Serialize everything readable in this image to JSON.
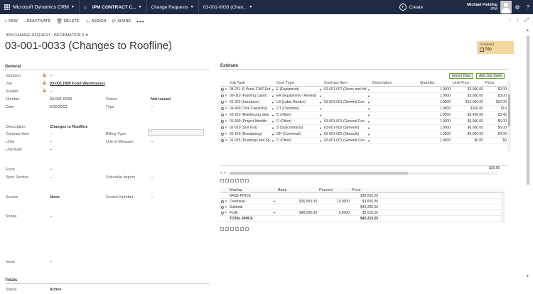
{
  "topbar": {
    "app_title": "Microsoft Dynamics CRM",
    "entity_tab": "IPM CONTRACT C...",
    "change_requests": "Change Requests",
    "record_tab": "03-001-0033 (Chan...",
    "create": "Create",
    "user_name": "Michael Fielding",
    "user_org": "IPM"
  },
  "cmdbar": {
    "new": "NEW",
    "deactivate": "DEACTIVATE",
    "delete": "DELETE",
    "assign": "ASSIGN",
    "share": "SHARE",
    "more": "•••"
  },
  "header": {
    "entity_label": "IPM CHANGE REQUEST : INFORMATION 2",
    "title": "03-001-0033 (Changes to Roofline)",
    "status_label": "Finalized",
    "status_value": "No"
  },
  "general": {
    "section": "General",
    "variation_label": "Variation",
    "variation_value": "--",
    "job_label": "Job",
    "job_value": "03-001 (NW Food Warehouse)",
    "subjob_label": "Subjob",
    "subjob_value": "--",
    "number_label": "Number",
    "number_value": "03-001-0033",
    "status_label": "Status",
    "status_value": "Not issued",
    "date_label": "Date",
    "date_value": "6/10/2013",
    "type_label": "Type",
    "type_value": "--",
    "description_label": "Description",
    "description_value": "Changes to Roofline",
    "contract_item_label": "Contract Item",
    "contract_item_value": "--",
    "billing_type_label": "Billing Type",
    "billing_type_value": "--",
    "units_label": "Units",
    "units_value": "--",
    "uom_label": "Unit of Measure",
    "uom_value": "--",
    "unit_rate_label": "Unit Rate",
    "unit_rate_value": "--",
    "from_label": "From",
    "from_value": "--",
    "spec_section_label": "Spec Section",
    "spec_section_value": "--",
    "schedule_impact_label": "Schedule Impact",
    "schedule_impact_value": "--",
    "source_label": "Source",
    "source_value": "None",
    "source_number_label": "Source Number",
    "source_number_value": "--",
    "scope_label": "Scope",
    "scope_value": "--",
    "issue_label": "Issue",
    "issue_value": "--"
  },
  "totals": {
    "section": "Totals",
    "status_label": "Status",
    "status_value": "Active"
  },
  "estimate": {
    "section": "Estimate",
    "import_btn": "Import Data",
    "add_tasks_btn": "Add Job Tasks",
    "columns": [
      "Job Task",
      "Cost Type",
      "Contract Item",
      "Description",
      "Quantity",
      "Unit Price",
      "Price"
    ],
    "rows": [
      {
        "job": "08-211 (6-Panel CWP Ent",
        "cost": "E (Equipment)",
        "contract": "03-001-007 (Doors and Hd",
        "qty": "1.0000",
        "unit": "$2,000.00",
        "price": "$2,00"
      },
      {
        "job": "06-010 (Framing Labor)",
        "cost": "ER (Equipment - Rented)",
        "contract": "",
        "qty": "1.0000",
        "unit": "$3,000.00",
        "price": "$3,00"
      },
      {
        "job": "01-023 (Insurance)",
        "cost": "LB (Labor Burden)",
        "contract": "03-001-001 (General Con",
        "qty": "1.0000",
        "unit": "$12,000.00",
        "price": "$12,00"
      },
      {
        "job": "09-400 (Trim Carpentry)",
        "cost": "OT (Overtime)",
        "contract": "",
        "qty": "1.0000",
        "unit": "$100.00",
        "price": "$10"
      },
      {
        "job": "03-210 (Reinforcing Stee",
        "cost": "O (Other)",
        "contract": "",
        "qty": "1.0000",
        "unit": "$3,450.00",
        "price": "$3,45"
      },
      {
        "job": "01-580 (Project Identific",
        "cost": "O (Other)",
        "contract": "03-001-001 (General Con",
        "qty": "1.0000",
        "unit": "$6,000.00",
        "price": "$6,00"
      },
      {
        "job": "02-010 (Soil Test)",
        "cost": "S (Subcontracts)",
        "contract": "03-001-002 (Sitework)",
        "qty": "1.0000",
        "unit": "$6,000.00",
        "price": "$6,00"
      },
      {
        "job": "02-140 (Dewatering)",
        "cost": "OH (Overhead)",
        "contract": "03-001-002 (Sitework)",
        "qty": "1.0000",
        "unit": "$4,000.00",
        "price": "$4,00"
      },
      {
        "job": "01-025 (Drawings and Sp",
        "cost": "O (Other)",
        "contract": "03-001-001 (General Con",
        "qty": "1.0000",
        "unit": "$0.00",
        "price": "$0"
      }
    ],
    "total": "$36,55"
  },
  "markup": {
    "columns": [
      "Markup",
      "Base",
      "Percent",
      "Price"
    ],
    "rows": [
      {
        "name": "BASE PRICE",
        "base": "",
        "pct": "",
        "price": "$36,550.00",
        "ctl": false,
        "bold": false
      },
      {
        "name": "Overhead",
        "base": "$36,550.00",
        "pct": "10.0000",
        "price": "$3,655.00",
        "ctl": true,
        "bold": false
      },
      {
        "name": "Subtotal",
        "base": "",
        "pct": "",
        "price": "$40,205.00",
        "ctl": true,
        "bold": false
      },
      {
        "name": "Profit",
        "base": "$40,205.00",
        "pct": "5.0000",
        "price": "$2,010.25",
        "ctl": true,
        "bold": false
      },
      {
        "name": "TOTAL PRICE",
        "base": "",
        "pct": "",
        "price": "$42,215.25",
        "ctl": false,
        "bold": true
      }
    ]
  }
}
